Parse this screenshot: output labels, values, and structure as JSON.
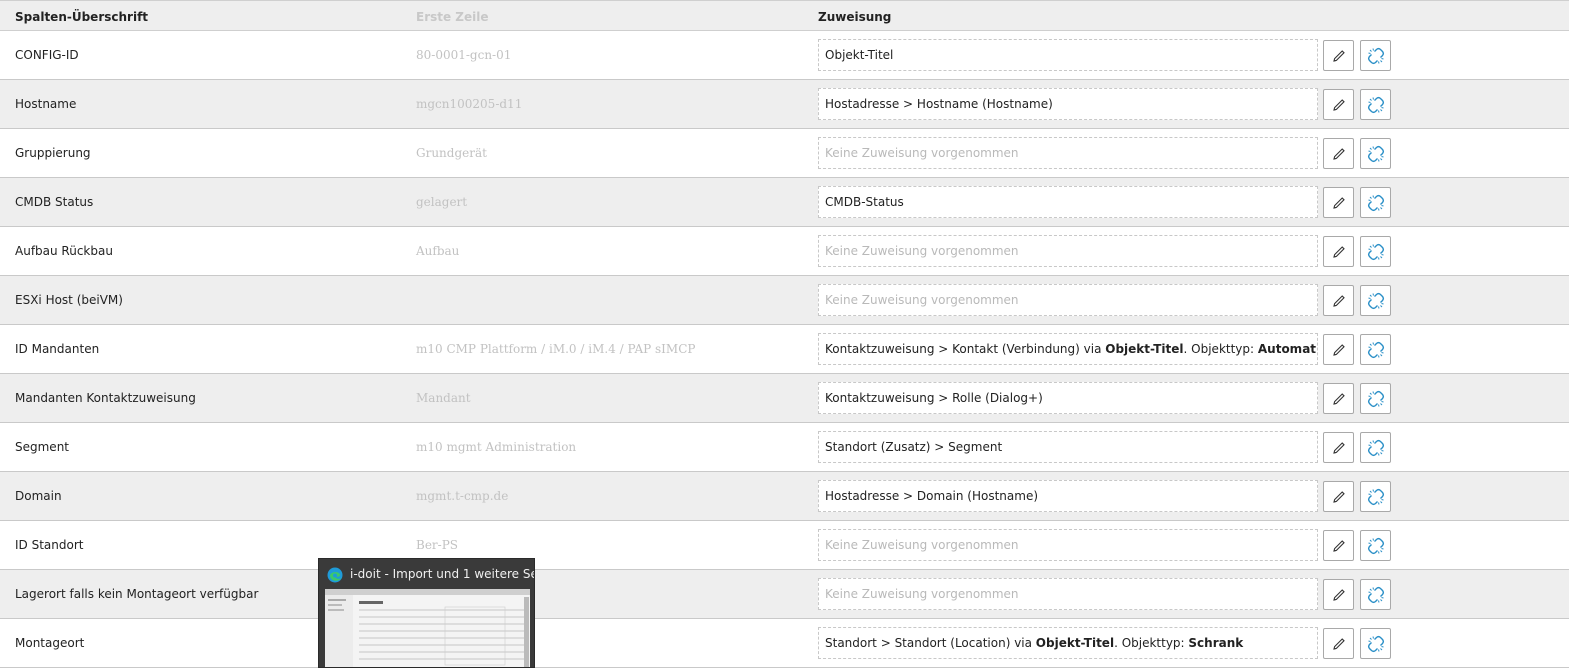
{
  "header": {
    "col1": "Spalten-Überschrift",
    "col2": "Erste Zeile",
    "col3": "Zuweisung"
  },
  "rows": [
    {
      "heading": "CONFIG-ID",
      "first": "80-0001-gcn-01",
      "assign": "Objekt-Titel",
      "empty": false
    },
    {
      "heading": "Hostname",
      "first": "mgcn100205-d11",
      "assign": "Hostadresse > Hostname (Hostname)",
      "empty": false
    },
    {
      "heading": "Gruppierung",
      "first": "Grundgerät",
      "assign": "Keine Zuweisung vorgenommen",
      "empty": true
    },
    {
      "heading": "CMDB Status",
      "first": "gelagert",
      "assign": "CMDB-Status",
      "empty": false
    },
    {
      "heading": "Aufbau Rückbau",
      "first": "Aufbau",
      "assign": "Keine Zuweisung vorgenommen",
      "empty": true
    },
    {
      "heading": "ESXi Host (beiVM)",
      "first": "",
      "assign": "Keine Zuweisung vorgenommen",
      "empty": true
    },
    {
      "heading": "ID Mandanten",
      "first": "m10 CMP Plattform / iM.0 / iM.4 / PAP sIMCP",
      "assign_parts": {
        "pre": "Kontaktzuweisung > Kontakt (Verbindung) via ",
        "bold1": "Objekt-Titel",
        "mid": ". Objekttyp: ",
        "bold2": "Automatisch"
      },
      "empty": false
    },
    {
      "heading": "Mandanten Kontaktzuweisung",
      "first": "Mandant",
      "assign": "Kontaktzuweisung > Rolle (Dialog+)",
      "empty": false
    },
    {
      "heading": "Segment",
      "first": "m10 mgmt Administration",
      "assign": "Standort (Zusatz) > Segment",
      "empty": false
    },
    {
      "heading": "Domain",
      "first": "mgmt.t-cmp.de",
      "assign": "Hostadresse > Domain (Hostname)",
      "empty": false
    },
    {
      "heading": "ID Standort",
      "first": "Ber-PS",
      "assign": "Keine Zuweisung vorgenommen",
      "empty": true
    },
    {
      "heading": "Lagerort falls kein Montageort verfügbar",
      "first": "",
      "assign": "Keine Zuweisung vorgenommen",
      "empty": true
    },
    {
      "heading": "Montageort",
      "first": "",
      "assign_parts": {
        "pre": "Standort > Standort (Location) via ",
        "bold1": "Objekt-Titel",
        "mid": ". Objekttyp: ",
        "bold2": "Schrank"
      },
      "empty": false
    }
  ],
  "icons": {
    "edit": "pencil-icon",
    "unlink": "unlink-icon",
    "browser": "edge-browser-icon"
  },
  "preview": {
    "title": "i-doit - Import und 1 weitere Se..."
  },
  "colors": {
    "unlink_icon": "#2a8fc7",
    "header_bg": "#eeeeee",
    "row_alt_bg": "#eeeeee"
  }
}
